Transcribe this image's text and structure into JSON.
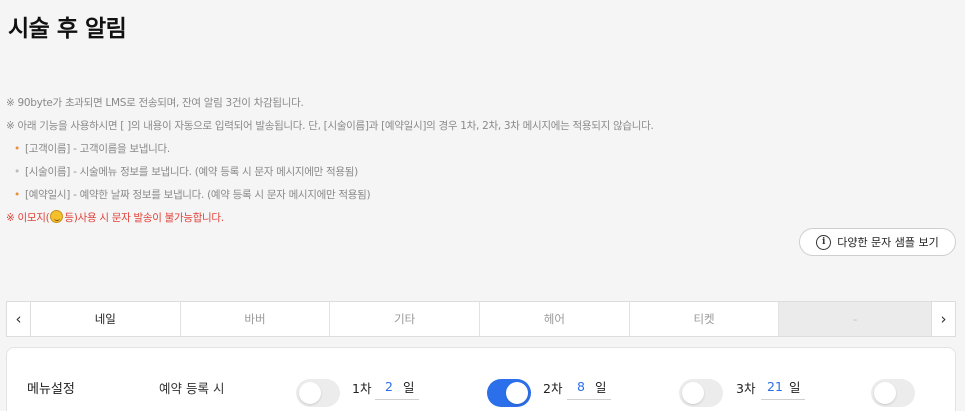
{
  "page": {
    "title": "시술 후 알림"
  },
  "notes": {
    "line1": "※ 90byte가 초과되면 LMS로 전송되며, 잔여 알림 3건이 차감됩니다.",
    "line2": "※ 아래 기능을 사용하시면 [ ]의 내용이 자동으로 입력되어 발송됩니다.  단, [시술이름]과 [예약일시]의 경우 1차, 2차, 3차 메시지에는 적용되지 않습니다.",
    "items": [
      {
        "bullet": "•",
        "text": "[고객이름] - 고객이름을 보냅니다."
      },
      {
        "bullet": "•",
        "text": "[시술이름] - 시술메뉴 정보를 보냅니다. (예약 등록 시 문자 메시지에만 적용됨)"
      },
      {
        "bullet": "•",
        "text": "[예약일시] - 예약한 날짜 정보를 보냅니다. (예약 등록 시 문자 메시지에만 적용됨)"
      }
    ],
    "warning_prefix": "※ 이모지(",
    "warning_suffix": "등)사용 시 문자 발송이 불가능합니다."
  },
  "sample_button": {
    "label": "다양한 문자 샘플 보기",
    "icon": "info-icon"
  },
  "tabs": {
    "prev": "‹",
    "next": "›",
    "items": [
      {
        "label": "네일",
        "state": "active"
      },
      {
        "label": "바버",
        "state": "normal"
      },
      {
        "label": "기타",
        "state": "normal"
      },
      {
        "label": "헤어",
        "state": "normal"
      },
      {
        "label": "티켓",
        "state": "normal"
      },
      {
        "label": "-",
        "state": "disabled"
      }
    ]
  },
  "settings": {
    "menu_label": "메뉴설정",
    "reservation_label": "예약 등록 시",
    "reservation_toggle": false,
    "steps": [
      {
        "label": "1차",
        "days": "2",
        "unit": "일",
        "enabled": true
      },
      {
        "label": "2차",
        "days": "8",
        "unit": "일",
        "enabled": false
      },
      {
        "label": "3차",
        "days": "21",
        "unit": "일",
        "enabled": false
      }
    ]
  },
  "colors": {
    "accent": "#2c6fea",
    "warning": "#e0433a",
    "bullet_orange": "#e8913a"
  }
}
